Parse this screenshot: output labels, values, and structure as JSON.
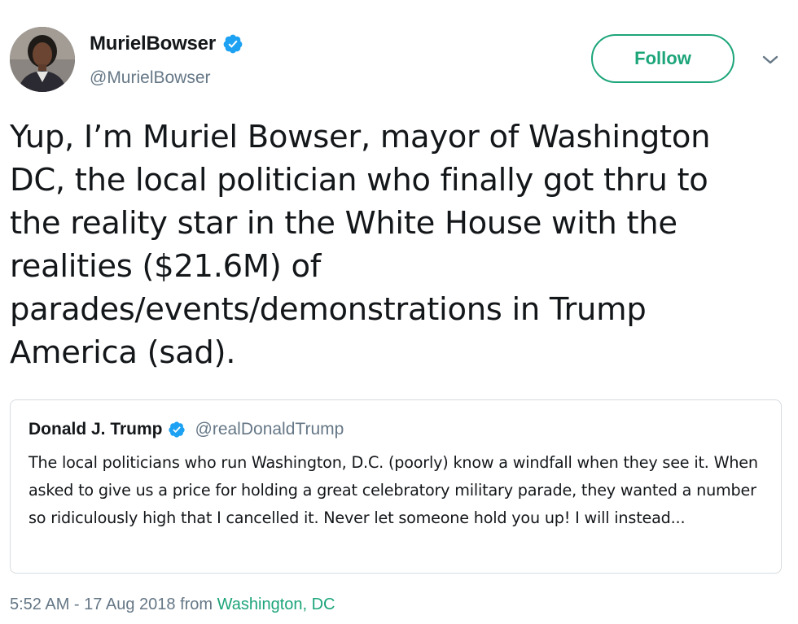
{
  "author": {
    "display_name": "MurielBowser",
    "handle": "@MurielBowser",
    "verified": true,
    "avatar": "profile-photo"
  },
  "follow_button": {
    "label": "Follow",
    "color": "#1da57a"
  },
  "menu": {
    "icon": "chevron-down-icon"
  },
  "tweet": {
    "text": "Yup, I’m Muriel Bowser, mayor of Washington\nDC, the local politician who finally got thru to\nthe reality star in the White House with the\nrealities ($21.6M) of\nparades/events/demonstrations in Trump\nAmerica (sad)."
  },
  "quoted_tweet": {
    "display_name": "Donald J. Trump",
    "handle": "@realDonaldTrump",
    "verified": true,
    "text": "The local politicians who run Washington, D.C. (poorly) know a windfall when they see it. When asked to give us a price for holding a great celebratory military parade, they wanted a number so ridiculously high that I cancelled it. Never let someone hold you up! I will instead..."
  },
  "meta": {
    "time_date": "5:52 AM - 17 Aug 2018",
    "from_label": "from",
    "location": "Washington, DC"
  },
  "colors": {
    "verified_blue": "#1da1f2",
    "secondary_text": "#657786",
    "accent_green": "#1da57a"
  }
}
